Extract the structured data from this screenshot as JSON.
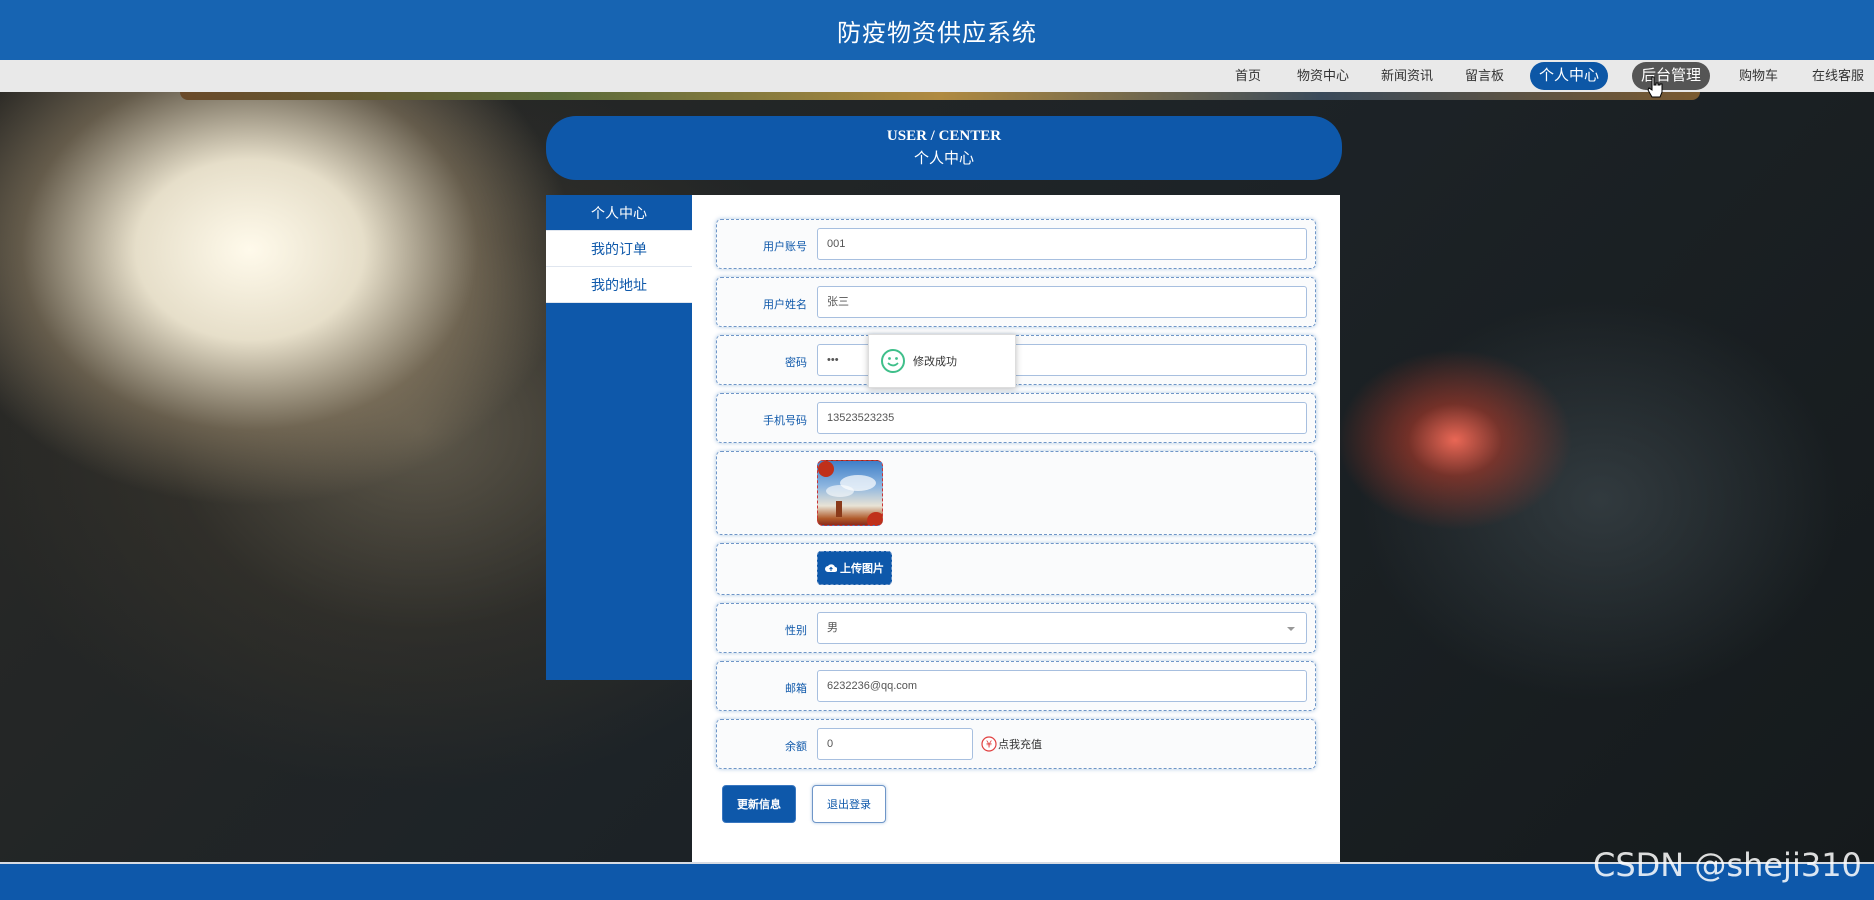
{
  "header": {
    "title": "防疫物资供应系统"
  },
  "nav": {
    "items": [
      {
        "label": "首页"
      },
      {
        "label": "物资中心"
      },
      {
        "label": "新闻资讯"
      },
      {
        "label": "留言板"
      },
      {
        "label": "个人中心",
        "state": "active"
      },
      {
        "label": "后台管理",
        "state": "hover"
      },
      {
        "label": "购物车"
      },
      {
        "label": "在线客服"
      }
    ]
  },
  "banner": {
    "en": "USER / CENTER",
    "cn": "个人中心"
  },
  "sidebar": {
    "items": [
      {
        "label": "个人中心",
        "state": "active"
      },
      {
        "label": "我的订单"
      },
      {
        "label": "我的地址"
      }
    ]
  },
  "form": {
    "username": {
      "label": "用户账号",
      "value": "001"
    },
    "name": {
      "label": "用户姓名",
      "value": "张三"
    },
    "password": {
      "label": "密码",
      "value": "•••"
    },
    "phone": {
      "label": "手机号码",
      "value": "13523523235"
    },
    "upload_label": "上传图片",
    "gender": {
      "label": "性别",
      "value": "男"
    },
    "email": {
      "label": "邮箱",
      "value": "6232236@qq.com"
    },
    "balance": {
      "label": "余额",
      "value": "0",
      "recharge_label": "点我充值"
    },
    "update_button": "更新信息",
    "logout_button": "退出登录"
  },
  "toast": {
    "message": "修改成功"
  },
  "watermark": "CSDN @sheji310",
  "colors": {
    "primary": "#0e58aa",
    "topbar": "#1764b2",
    "navbar": "#e9e9e9"
  }
}
